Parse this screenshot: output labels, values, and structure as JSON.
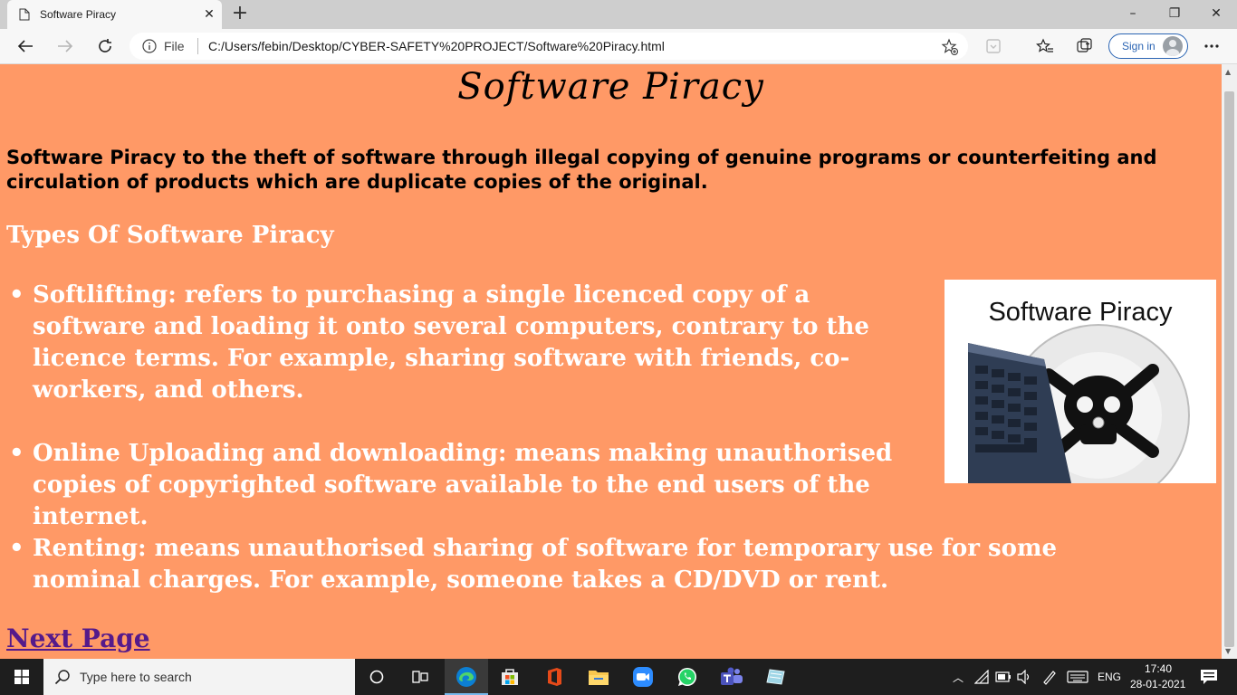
{
  "browser": {
    "tab_title": "Software Piracy",
    "tab_close": "✕",
    "new_tab": "+",
    "address_scheme": "File",
    "address_url": "C:/Users/febin/Desktop/CYBER-SAFETY%20PROJECT/Software%20Piracy.html",
    "sign_in_label": "Sign in",
    "window_minimize": "–",
    "window_restore": "❐",
    "window_close": "✕"
  },
  "page": {
    "background_color": "#ff9966",
    "title": "Software Piracy",
    "intro": "Software Piracy to the theft of software through illegal copying of genuine programs or counterfeiting and circulation of products which are duplicate copies of the original.",
    "types_heading": "Types Of Software Piracy",
    "types": [
      "Softlifting: refers to purchasing a single licenced copy of a software and loading it onto several computers, contrary to the licence terms. For example, sharing software with friends, co-workers, and others.",
      "Online Uploading and downloading: means making unauthorised copies of copyrighted software available to the end users of the internet.",
      "Renting: means unauthorised sharing of software for temporary use for some nominal charges. For example, someone takes a CD/DVD or rent."
    ],
    "image_caption": "Software Piracy",
    "next_link": "Next Page"
  },
  "taskbar": {
    "search_placeholder": "Type here to search",
    "language": "ENG",
    "time": "17:40",
    "date": "28-01-2021",
    "apps": [
      "cortana-icon",
      "task-view-icon",
      "edge-icon",
      "store-icon",
      "office-icon",
      "file-explorer-icon",
      "zoom-icon",
      "whatsapp-icon",
      "teams-icon",
      "sticky-app-icon"
    ]
  }
}
